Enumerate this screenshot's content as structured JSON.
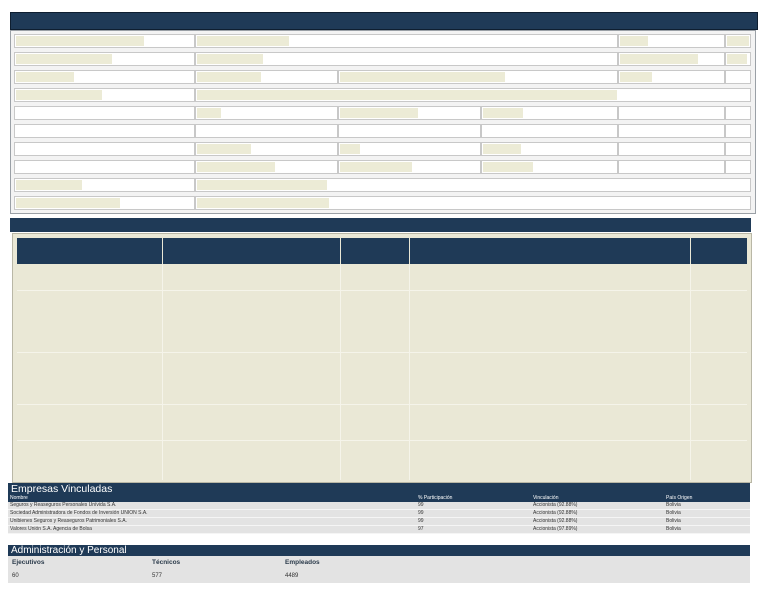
{
  "companies": {
    "title": "Empresas Vinculadas",
    "columns": [
      "Nombre",
      "% Participación",
      "Vinculación",
      "País Origen"
    ],
    "rows": [
      {
        "name": "Seguros y Reaseguros Personales Unívida S.A.",
        "pct": "99",
        "link": "Accionista (92.88%)",
        "country": "Bolivia"
      },
      {
        "name": "Sociedad Administradora de Fondos de Inversión UNION S.A.",
        "pct": "99",
        "link": "Accionista (92.88%)",
        "country": "Bolivia"
      },
      {
        "name": "Unibienes Seguros y Reaseguros Patrimoniales S.A.",
        "pct": "99",
        "link": "Accionista (92.88%)",
        "country": "Bolivia"
      },
      {
        "name": "Valores Unión S.A. Agencia de Bolsa",
        "pct": "97",
        "link": "Accionista (97.89%)",
        "country": "Bolivia"
      }
    ]
  },
  "admin": {
    "title": "Administración y Personal",
    "executives_label": "Ejecutivos",
    "technicians_label": "Técnicos",
    "employees_label": "Empleados",
    "executives": "60",
    "technicians": "577",
    "employees": "4489"
  },
  "colors": {
    "header_navy": "#1f3a57",
    "grid_bg": "#eae8d6",
    "row_bg": "#e3e3e3"
  }
}
